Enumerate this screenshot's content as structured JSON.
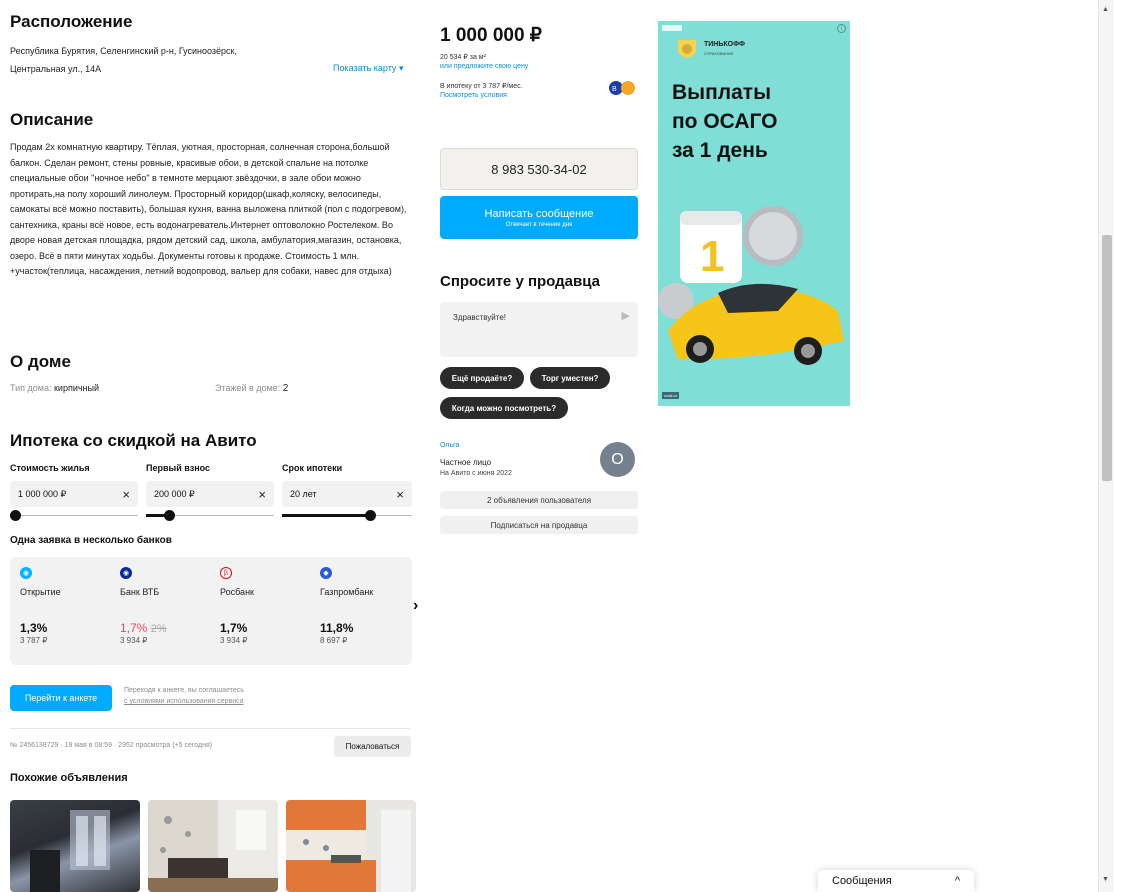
{
  "location": {
    "title": "Расположение",
    "address_line1": "Республика Бурятия, Селенгинский р-н, Гусиноозёрск,",
    "address_line2": "Центральная ул., 14А",
    "show_map": "Показать карту"
  },
  "description": {
    "title": "Описание",
    "text": "Продам 2х комнатную квартиру. Тёплая, уютная, просторная, солнечная сторона,большой балкон. Сделан ремонт, стены ровные, красивые обои, в детской спальне на потолке специальные обои \"ночное небо\" в темноте мерцают звёздочки, в зале обои можно протирать,на полу хороший линолеум. Просторный коридор(шкаф,коляску, велосипеды, самокаты всё можно поставить), большая кухня, ванна выложена плиткой (пол с подогревом), сантехника, краны всё новое, есть водонагреватель.Интернет оптоволокно Ростелеком. Во дворе новая детская площадка, рядом детский сад, школа, амбулатория,магазин, остановка, озеро. Всё в пяти минутах ходьбы. Документы готовы к продаже. Стоимость 1 млн. +участок(теплица, насаждения, летний водопровод, вальер для собаки, навес для отдыха)"
  },
  "house": {
    "title": "О доме",
    "type_label": "Тип дома:",
    "type_value": "кирпичный",
    "floors_label": "Этажей в доме:",
    "floors_value": "2"
  },
  "mortgage": {
    "title": "Ипотека со скидкой на Авито",
    "cost_label": "Стоимость жилья",
    "cost_value": "1 000 000 ₽",
    "down_label": "Первый взнос",
    "down_value": "200 000 ₽",
    "term_label": "Срок ипотеки",
    "term_value": "20 лет",
    "clear": "×",
    "cost_level": 0.0,
    "down_level": 0.15,
    "term_level": 0.7,
    "banks_title": "Одна заявка в несколько банков",
    "banks": [
      {
        "name": "Открытие",
        "rate": "1,3%",
        "old_rate": "",
        "payment": "3 787 ₽",
        "color": "#00b2ff",
        "icon": "otkritie-icon"
      },
      {
        "name": "Банк ВТБ",
        "rate": "1,7%",
        "old_rate": "2%",
        "payment": "3 934 ₽",
        "color": "#0a2896",
        "icon": "vtb-icon"
      },
      {
        "name": "Росбанк",
        "rate": "1,7%",
        "old_rate": "",
        "payment": "3 934 ₽",
        "color": "#e30613",
        "icon": "rosbank-icon"
      },
      {
        "name": "Газпромбанк",
        "rate": "11,8%",
        "old_rate": "",
        "payment": "8 697 ₽",
        "color": "#2a5bd7",
        "icon": "gazprombank-icon"
      }
    ],
    "next_arrow": "›",
    "apply_button": "Перейти к анкете",
    "terms_line1": "Переходя к анкете, вы соглашаетесь",
    "terms_line2": "с условиями использования сервиса"
  },
  "meta": {
    "info": "№ 2456138729 · 19 мая в 08:59 · 2952 просмотра (+5 сегодня)",
    "complain": "Пожаловаться"
  },
  "similar": {
    "title": "Похожие объявления"
  },
  "price": {
    "value": "1 000 000 ₽",
    "per_meter": "20 534 ₽ за м²",
    "offer": "или предложите свою цену",
    "mortgage_from": "В ипотеку от 3 787 ₽/мес.",
    "conditions": "Посмотреть условия"
  },
  "contact": {
    "phone": "8 983 530-34-02",
    "message_button": "Написать сообщение",
    "message_sub": "Отвечает в течение дня"
  },
  "ask": {
    "title": "Спросите у продавца",
    "placeholder": "Здравствуйте!",
    "chips": [
      "Ещё продаёте?",
      "Торг уместен?",
      "Когда можно посмотреть?"
    ]
  },
  "seller": {
    "name": "Ольга",
    "type": "Частное лицо",
    "since": "На Авито с июня 2022",
    "avatar_letter": "О",
    "ads_button": "2 объявления пользователя",
    "subscribe_button": "Подписаться на продавца"
  },
  "ad": {
    "brand": "ТИНЬКОФФ",
    "brand_sub": "СТРАХОВАНИЕ",
    "line1": "Выплаты",
    "line2": "по ОСАГО",
    "line3": "за 1 день",
    "badge_icon": "ad-badge-icon",
    "info_icon": "info-icon",
    "footer": "oosit.ru"
  },
  "messages_bar": {
    "label": "Сообщения",
    "chevron": "^"
  }
}
